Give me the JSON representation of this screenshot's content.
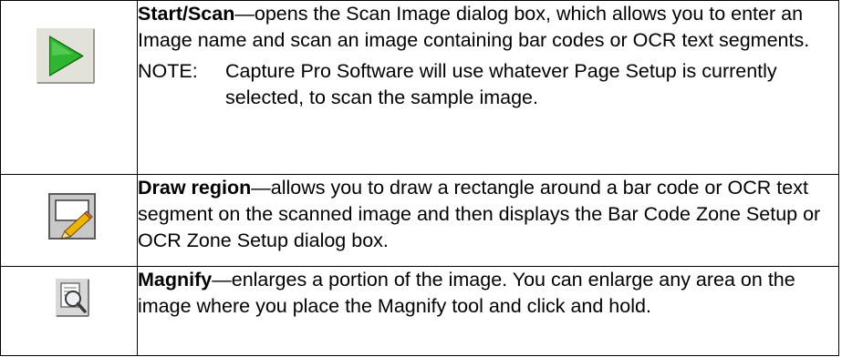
{
  "rows": [
    {
      "icon": "start-scan-icon",
      "term": "Start/Scan",
      "desc": "—opens the Scan Image dialog box, which allows you to enter an Image name and scan an image containing bar codes or OCR text segments.",
      "note_label": "NOTE:",
      "note_text": "Capture Pro Software will use whatever Page Setup is currently selected, to scan the sample image."
    },
    {
      "icon": "draw-region-icon",
      "term": "Draw region",
      "desc": "—allows you to draw a rectangle around a bar code or OCR text segment on the scanned image and then displays the Bar Code Zone Setup or OCR Zone Setup dialog box."
    },
    {
      "icon": "magnify-icon",
      "term": "Magnify",
      "desc": "—enlarges a portion of the image. You can enlarge any area on the image where you place the Magnify tool and click and hold."
    }
  ],
  "colors": {
    "start_green": "#2fb52f",
    "border": "#000000"
  }
}
